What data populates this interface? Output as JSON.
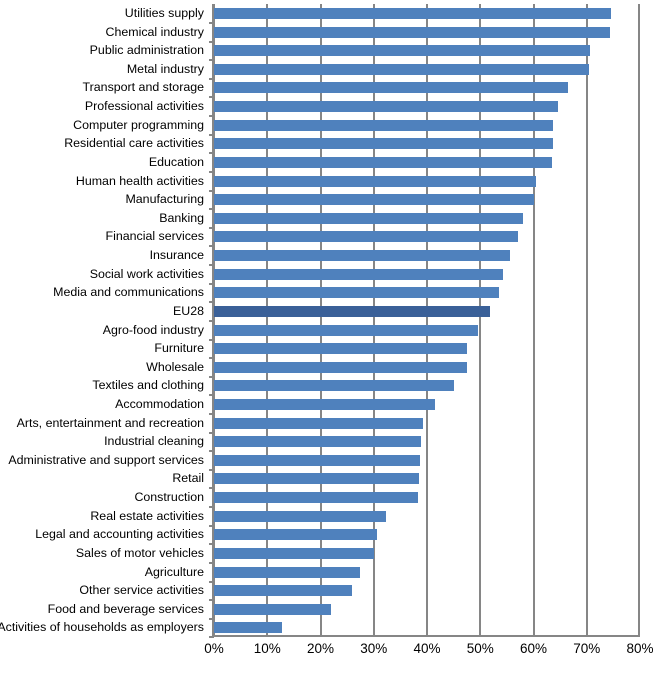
{
  "chart_data": {
    "type": "bar",
    "orientation": "horizontal",
    "title": "",
    "subtitle": "",
    "xlabel": "",
    "ylabel": "",
    "xlim": [
      0,
      80
    ],
    "xtick_labels": [
      "0%",
      "10%",
      "20%",
      "30%",
      "40%",
      "50%",
      "60%",
      "70%",
      "80%"
    ],
    "xtick_values": [
      0,
      10,
      20,
      30,
      40,
      50,
      60,
      70,
      80
    ],
    "grid": true,
    "legend": "none",
    "value_unit": "%",
    "series_color": "#4F81BD",
    "highlight_color": "#3A6098",
    "highlight_category": "EU28",
    "categories": [
      "Utilities supply",
      "Chemical industry",
      "Public administration",
      "Metal industry",
      "Transport and storage",
      "Professional activities",
      "Computer programming",
      "Residential care activities",
      "Education",
      "Human health activities",
      "Manufacturing",
      "Banking",
      "Financial services",
      "Insurance",
      "Social work activities",
      "Media and communications",
      "EU28",
      "Agro-food industry",
      "Furniture",
      "Wholesale",
      "Textiles and clothing",
      "Accommodation",
      "Arts, entertainment and recreation",
      "Industrial cleaning",
      "Administrative and support services",
      "Retail",
      "Construction",
      "Real estate activities",
      "Legal and accounting activities",
      "Sales of motor vehicles",
      "Agriculture",
      "Other service activities",
      "Food and beverage services",
      "Activities of households as employers"
    ],
    "values": [
      74.6,
      74.3,
      70.6,
      70.4,
      66.5,
      64.6,
      63.6,
      63.6,
      63.5,
      60.5,
      60.0,
      58.0,
      57.0,
      55.6,
      54.2,
      53.6,
      51.9,
      49.5,
      47.6,
      47.5,
      45.0,
      41.5,
      39.2,
      38.8,
      38.6,
      38.5,
      38.3,
      32.3,
      30.7,
      30.0,
      27.5,
      26.0,
      22.0,
      12.8
    ]
  }
}
